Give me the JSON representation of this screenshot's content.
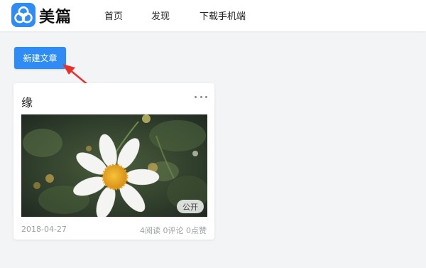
{
  "brand": {
    "name": "美篇",
    "color": "#2f8cf5",
    "icon": "meipian-logo-icon"
  },
  "nav": [
    {
      "label": "首页"
    },
    {
      "label": "发现"
    },
    {
      "label": "下载手机端"
    }
  ],
  "toolbar": {
    "new_article_label": "新建文章"
  },
  "annotation": {
    "icon": "red-arrow-icon",
    "color": "#e5322d"
  },
  "article": {
    "title": "缘",
    "more_icon": "more-dots-icon",
    "image": "daisy-flower-photo",
    "visibility_badge": "公开",
    "date": "2018-04-27",
    "stats": "4阅读 0评论 0点赞"
  }
}
